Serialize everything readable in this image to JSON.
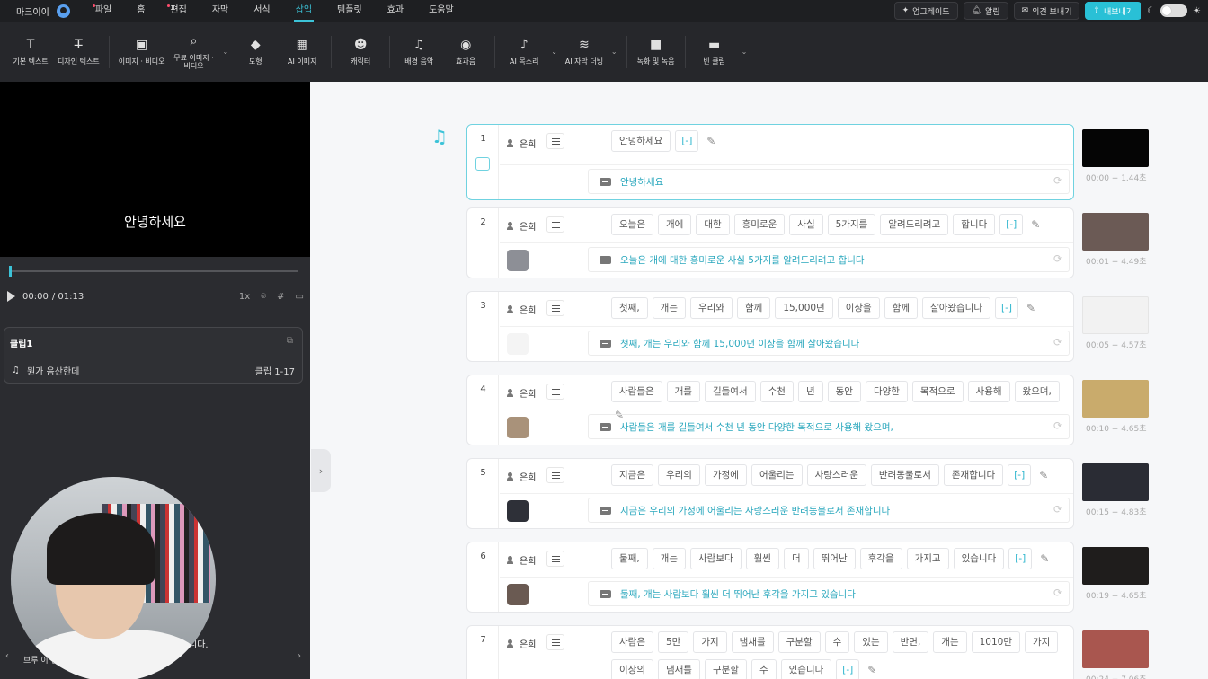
{
  "app": {
    "brand": "마크이이",
    "menu": [
      {
        "label": "파일",
        "dot": true,
        "active": false
      },
      {
        "label": "홈",
        "dot": false,
        "active": false
      },
      {
        "label": "편집",
        "dot": true,
        "active": false
      },
      {
        "label": "자막",
        "dot": false,
        "active": false
      },
      {
        "label": "서식",
        "dot": false,
        "active": false
      },
      {
        "label": "삽입",
        "dot": false,
        "active": true
      },
      {
        "label": "템플릿",
        "dot": false,
        "active": false
      },
      {
        "label": "효과",
        "dot": false,
        "active": false
      },
      {
        "label": "도움말",
        "dot": false,
        "active": false
      }
    ],
    "right": {
      "upgrade": "업그레이드",
      "alarm": "알림",
      "feedback": "의견 보내기",
      "export": "내보내기"
    }
  },
  "toolbar": [
    {
      "label": "기본 텍스트",
      "icon": "text-icon"
    },
    {
      "label": "디자인 텍스트",
      "icon": "design-text-icon"
    },
    {
      "label": "이미지 · 비디오",
      "icon": "image-icon"
    },
    {
      "label": "무료 이미지 · 비디오",
      "icon": "free-image-icon"
    },
    {
      "label": "도형",
      "icon": "shape-icon"
    },
    {
      "label": "AI 이미지",
      "icon": "ai-image-icon"
    },
    {
      "label": "캐릭터",
      "icon": "character-icon"
    },
    {
      "label": "배경 음악",
      "icon": "music-icon"
    },
    {
      "label": "효과음",
      "icon": "sound-effect-icon"
    },
    {
      "label": "AI 목소리",
      "icon": "ai-voice-icon"
    },
    {
      "label": "AI 자막 더빙",
      "icon": "ai-dubbing-icon"
    },
    {
      "label": "녹화 및 녹음",
      "icon": "record-icon"
    },
    {
      "label": "빈 클립",
      "icon": "empty-clip-icon"
    }
  ],
  "player": {
    "preview_text": "안녕하세요",
    "current": "00:00",
    "total": "/ 01:13",
    "speed": "1x",
    "progress": 0.0
  },
  "clip": {
    "title": "클립1",
    "music": "뭔가 음산한데",
    "range": "클립 1-17"
  },
  "notice": {
    "line1": "니다.",
    "line2": "브루 이                                        된되었습니다."
  },
  "rows": [
    {
      "num": "1",
      "speaker": "은희",
      "words": [
        "안녕하세요",
        "[-]"
      ],
      "subtitle": "안녕하세요",
      "time": "00:00 + 1.44초",
      "thumbColor": "#050505",
      "smallThumb": "",
      "selected": true
    },
    {
      "num": "2",
      "speaker": "은희",
      "words": [
        "오늘은",
        "개에",
        "대한",
        "흥미로운",
        "사실",
        "5가지를",
        "알려드리려고",
        "합니다",
        "[-]"
      ],
      "subtitle": "오늘은 개에 대한 흥미로운 사실 5가지를 알려드리려고 합니다",
      "time": "00:01 + 4.49초",
      "thumbColor": "#6b5a55",
      "smallThumb": "#8d8f96",
      "selected": false
    },
    {
      "num": "3",
      "speaker": "은희",
      "words": [
        "첫째,",
        "개는",
        "우리와",
        "함께",
        "15,000년",
        "이상을",
        "함께",
        "살아왔습니다",
        "[-]"
      ],
      "subtitle": "첫째, 개는 우리와 함께 15,000년 이상을 함께 살아왔습니다",
      "time": "00:05 + 4.57초",
      "thumbColor": "#f2f2f2",
      "smallThumb": "#f4f4f4",
      "selected": false
    },
    {
      "num": "4",
      "speaker": "은희",
      "words": [
        "사람들은",
        "개를",
        "길들여서",
        "수천",
        "년",
        "동안",
        "다양한",
        "목적으로",
        "사용해",
        "왔으며,"
      ],
      "subtitle": "사람들은 개를 길들여서 수천 년 동안 다양한 목적으로 사용해 왔으며,",
      "time": "00:10 + 4.65초",
      "thumbColor": "#c9ab6c",
      "smallThumb": "#a9927a",
      "selected": false
    },
    {
      "num": "5",
      "speaker": "은희",
      "words": [
        "지금은",
        "우리의",
        "가정에",
        "어울리는",
        "사랑스러운",
        "반려동물로서",
        "존재합니다",
        "[-]"
      ],
      "subtitle": "지금은 우리의 가정에 어울리는 사랑스러운 반려동물로서 존재합니다",
      "time": "00:15 + 4.83초",
      "thumbColor": "#2a2c34",
      "smallThumb": "#2e3038",
      "selected": false
    },
    {
      "num": "6",
      "speaker": "은희",
      "words": [
        "둘째,",
        "개는",
        "사람보다",
        "훨씬",
        "더",
        "뛰어난",
        "후각을",
        "가지고",
        "있습니다",
        "[-]"
      ],
      "subtitle": "둘째, 개는 사람보다 훨씬 더 뛰어난 후각을 가지고 있습니다",
      "time": "00:19 + 4.65초",
      "thumbColor": "#1f1d1c",
      "smallThumb": "#6a5a52",
      "selected": false
    },
    {
      "num": "7",
      "speaker": "은희",
      "words": [
        "사람은",
        "5만",
        "가지",
        "냄새를",
        "구분할",
        "수",
        "있는",
        "반면,",
        "개는",
        "1010만",
        "가지",
        "이상의",
        "냄새를",
        "구분할",
        "수",
        "있습니다",
        "[-]"
      ],
      "subtitle": "",
      "time": "00:24 + 7.06초",
      "thumbColor": "#a9564f",
      "smallThumb": "",
      "selected": false
    }
  ]
}
